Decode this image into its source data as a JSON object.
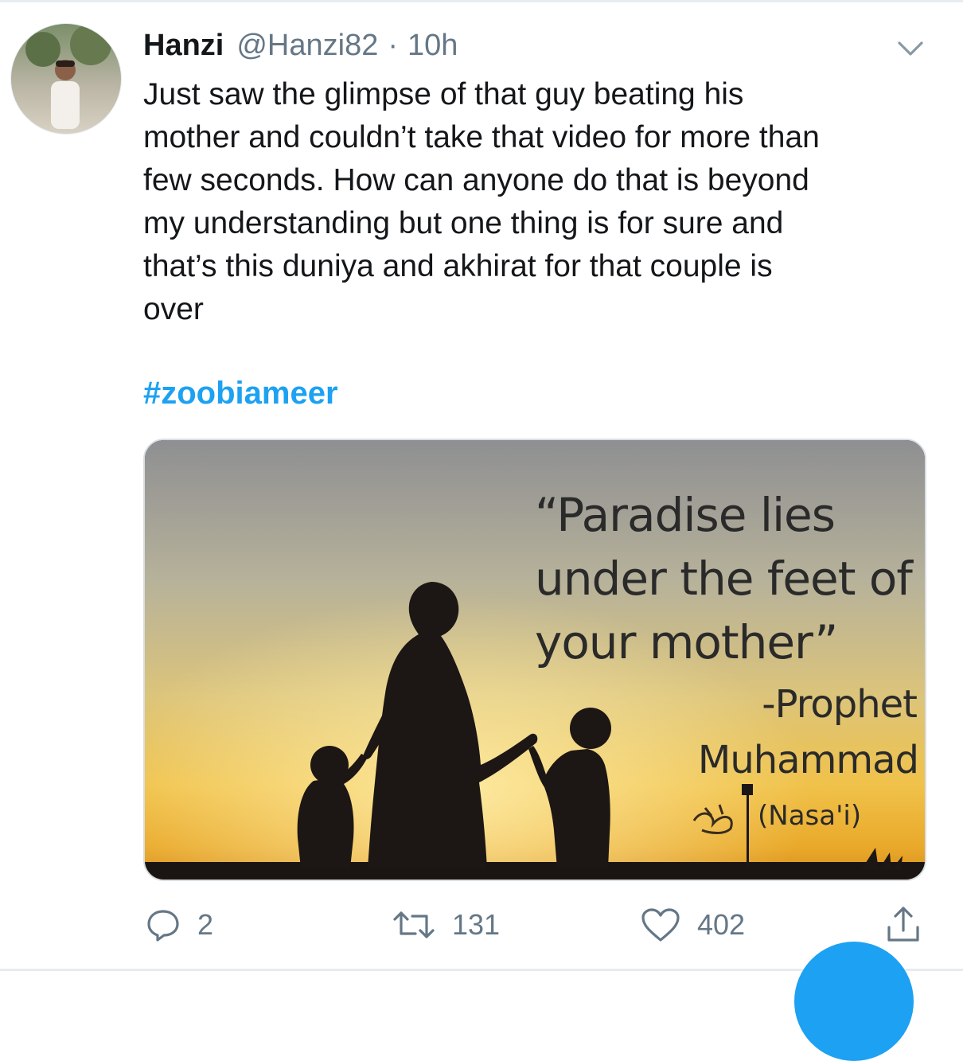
{
  "tweet": {
    "author_name": "Hanzi",
    "handle": "@Hanzi82",
    "separator": "·",
    "time": "10h",
    "text": "Just saw the glimpse of that guy beating his\nmother and couldn’t take that video for more than\nfew seconds. How can anyone do that is beyond\nmy understanding but one thing is for sure and\nthat’s this duniya and akhirat for that couple is\nover",
    "hashtag": "#zoobiameer"
  },
  "media": {
    "quote": "“Paradise lies under the feet of your mother”",
    "attribution_prefix": "-Prophet",
    "attribution_name": "Muhammad",
    "source": "(Nasa'i)"
  },
  "actions": {
    "replies": "2",
    "retweets": "131",
    "likes": "402"
  },
  "colors": {
    "link": "#1da1f2",
    "secondary_text": "#657786"
  },
  "icons": [
    "chevron-down-icon",
    "reply-icon",
    "retweet-icon",
    "like-icon",
    "share-icon"
  ]
}
